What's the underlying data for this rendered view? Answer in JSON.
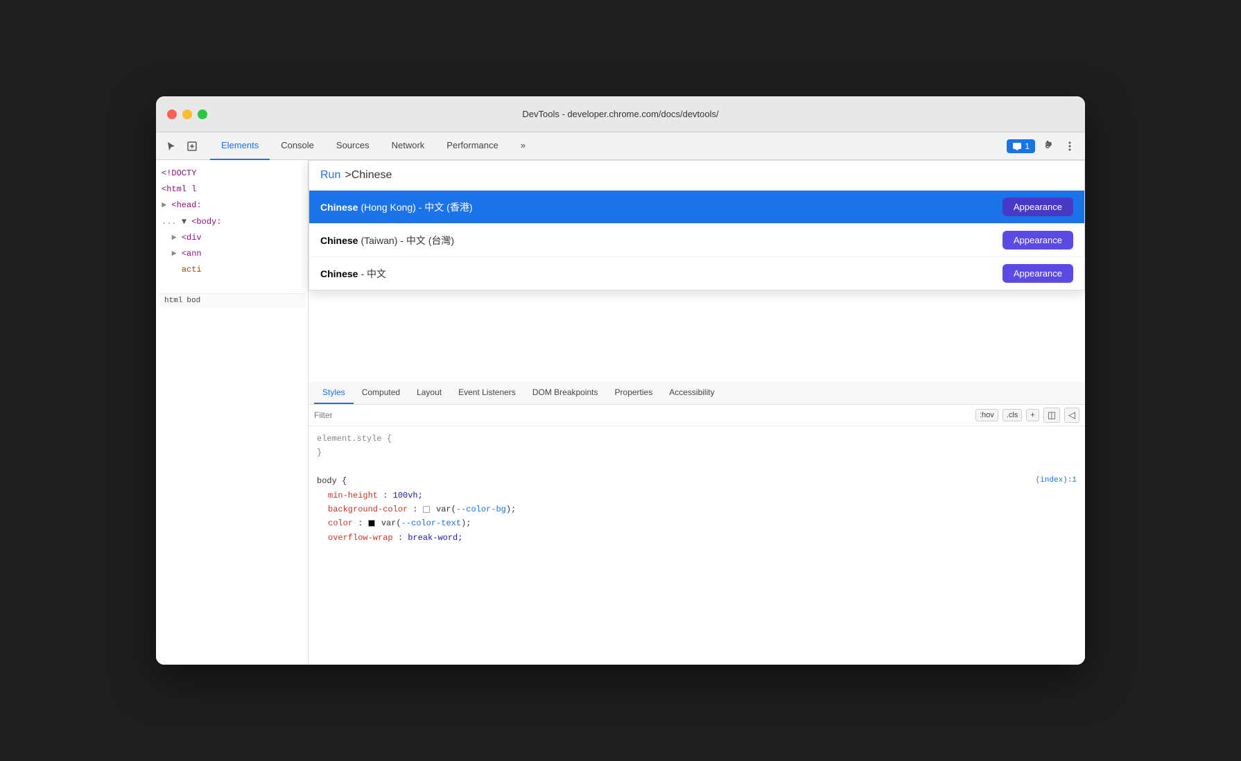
{
  "window": {
    "title": "DevTools - developer.chrome.com/docs/devtools/"
  },
  "toolbar": {
    "tabs": [
      {
        "label": "Elements",
        "active": true
      },
      {
        "label": "Console",
        "active": false
      },
      {
        "label": "Sources",
        "active": false
      },
      {
        "label": "Network",
        "active": false
      },
      {
        "label": "Performance",
        "active": false
      },
      {
        "label": "»",
        "active": false
      }
    ],
    "badge_label": "1",
    "more_tabs_label": "»"
  },
  "command_palette": {
    "run_label": "Run",
    "query": ">Chinese",
    "items": [
      {
        "bold": "Chinese",
        "rest": " (Hong Kong) - 中文 (香港)",
        "button": "Appearance",
        "selected": true
      },
      {
        "bold": "Chinese",
        "rest": " (Taiwan) - 中文 (台灣)",
        "button": "Appearance",
        "selected": false
      },
      {
        "bold": "Chinese",
        "rest": " - 中文",
        "button": "Appearance",
        "selected": false
      }
    ]
  },
  "dom": {
    "lines": [
      {
        "text": "<!DOCTY",
        "type": "normal"
      },
      {
        "text": "<html l",
        "type": "tag"
      },
      {
        "text": "► <head:",
        "type": "tag"
      },
      {
        "text": "... ▼ <body:",
        "type": "tag"
      },
      {
        "text": "  ► <div",
        "type": "tag"
      },
      {
        "text": "  ► <ann",
        "type": "tag"
      },
      {
        "text": "    acti",
        "type": "attr"
      }
    ]
  },
  "bottom_tabs": [
    "html",
    "bod"
  ],
  "panel_tabs": [
    {
      "label": "Styles",
      "active": true
    },
    {
      "label": "Computed",
      "active": false
    },
    {
      "label": "Layout",
      "active": false
    },
    {
      "label": "Event Listeners",
      "active": false
    },
    {
      "label": "DOM Breakpoints",
      "active": false
    },
    {
      "label": "Properties",
      "active": false
    },
    {
      "label": "Accessibility",
      "active": false
    }
  ],
  "styles": {
    "filter_placeholder": "Filter",
    "hov_label": ":hov",
    "cls_label": ".cls",
    "element_style": "element.style {",
    "element_style_close": "}",
    "body_rule": "body {",
    "body_source": "(index):1",
    "properties": [
      {
        "prop": "min-height",
        "value": "100vh;"
      },
      {
        "prop": "background-color",
        "swatch": "white",
        "value": "var(--color-bg);"
      },
      {
        "prop": "color",
        "swatch": "black",
        "value": "var(--color-text);"
      },
      {
        "prop": "overflow-wrap",
        "value": "break-word;"
      }
    ]
  }
}
